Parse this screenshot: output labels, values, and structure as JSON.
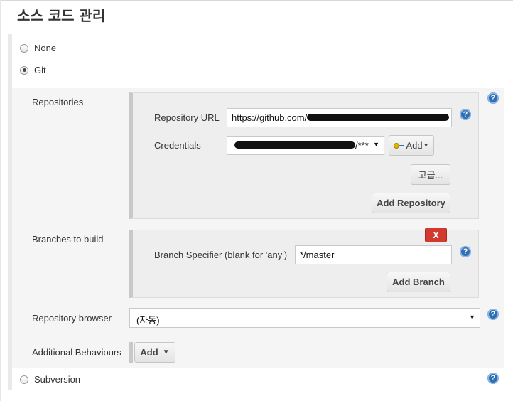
{
  "page": {
    "title": "소스 코드 관리"
  },
  "scm": {
    "none_label": "None",
    "git_label": "Git",
    "subversion_label": "Subversion"
  },
  "git": {
    "repositories_label": "Repositories",
    "repository_url_label": "Repository URL",
    "repository_url_value": "https://github.com/",
    "credentials_label": "Credentials",
    "credentials_value": "/*** ",
    "credentials_add_label": "Add",
    "advanced_label": "고급...",
    "add_repository_label": "Add Repository",
    "branches_label": "Branches to build",
    "branch_specifier_label": "Branch Specifier (blank for 'any')",
    "branch_specifier_value": "*/master",
    "delete_branch_label": "X",
    "add_branch_label": "Add Branch",
    "repository_browser_label": "Repository browser",
    "repository_browser_value": "(자동)",
    "additional_behaviours_label": "Additional Behaviours",
    "additional_add_label": "Add"
  },
  "help_glyph": "?",
  "dropdown_glyph": "▼",
  "icons": {
    "help": "help-icon",
    "key": "key-icon",
    "dropdown": "chevron-down-icon"
  },
  "colors": {
    "help_icon": "#2f6fb5",
    "delete_button": "#d23a2f"
  }
}
